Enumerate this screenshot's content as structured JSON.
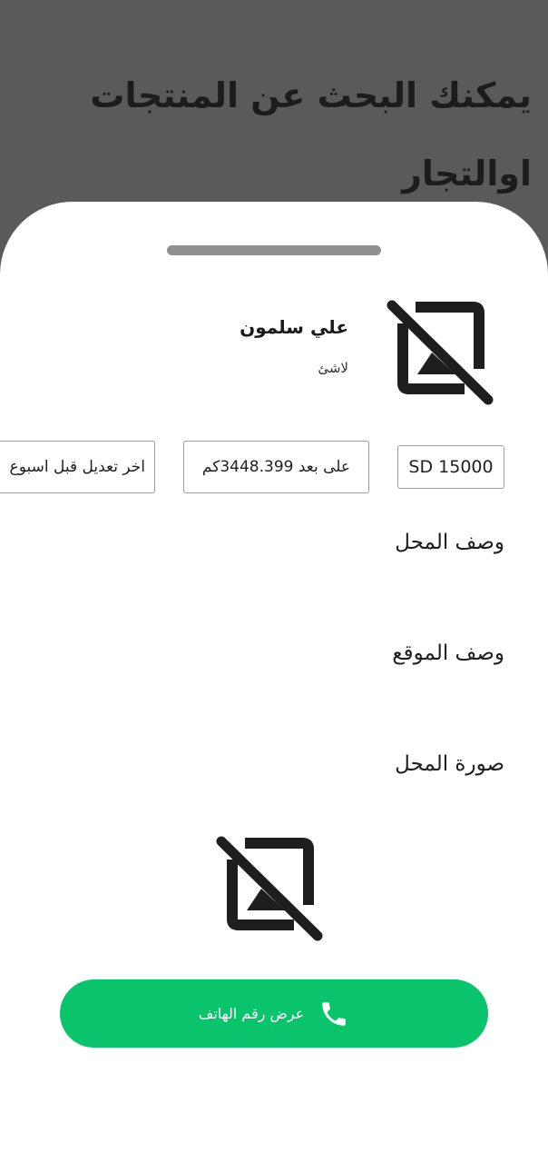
{
  "backdrop": {
    "title": "يمكنك البحث عن المنتجات اوالتجار"
  },
  "profile": {
    "name": "علي سلمون",
    "subtitle": "لاشئ",
    "image_icon": "broken-image-icon"
  },
  "chips": {
    "price": "SD 15000",
    "distance": "على بعد 3448.399كم",
    "last_modified": "اخر تعديل قبل اسبوع"
  },
  "sections": {
    "shop_description": "وصف المحل",
    "location_description": "وصف الموقع",
    "shop_photo": "صورة المحل"
  },
  "shop_image": {
    "icon": "broken-image-icon"
  },
  "call_button": {
    "label": "عرض رقم الهاتف",
    "icon": "phone-icon"
  },
  "colors": {
    "backdrop": "#5a5a5a",
    "sheet": "#ffffff",
    "accent_green": "#0ac46c",
    "handle": "#8f8f8f"
  }
}
